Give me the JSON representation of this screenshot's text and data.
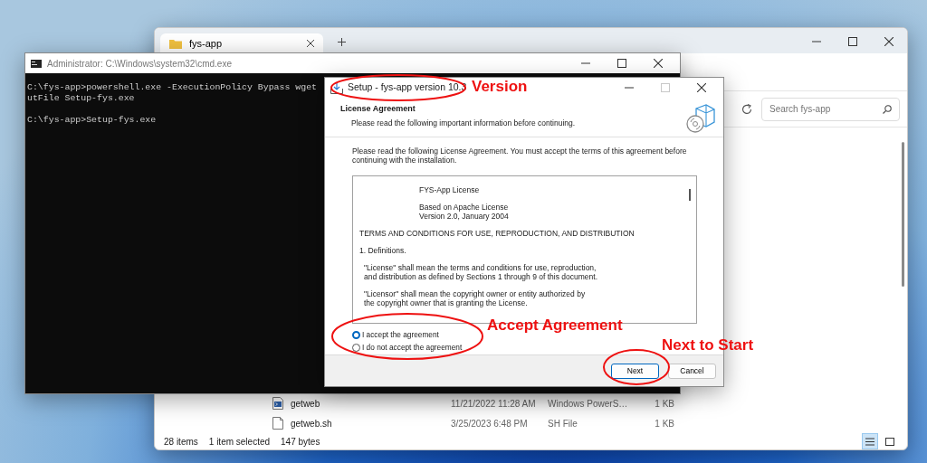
{
  "explorer": {
    "tab": {
      "label": "fys-app"
    },
    "search": {
      "placeholder": "Search fys-app"
    },
    "files": [
      {
        "name": "getweb",
        "date": "11/21/2022 11:28 AM",
        "type": "Windows PowerS…",
        "size": "1 KB",
        "kind": "script"
      },
      {
        "name": "getweb.sh",
        "date": "3/25/2023 6:48 PM",
        "type": "SH File",
        "size": "1 KB",
        "kind": "document"
      }
    ],
    "status_bar": [
      "28 items",
      "1 item selected",
      "147 bytes"
    ],
    "views": [
      {
        "kind": "details",
        "selected": true
      },
      {
        "kind": "tiles",
        "selected": false
      }
    ]
  },
  "console": {
    "title": "Administrator: C:\\Windows\\system32\\cmd.exe",
    "blocks": [
      [
        "C:\\fys-app>powershell.exe -ExecutionPolicy Bypass wget",
        "utFile Setup-fys.exe"
      ],
      [
        "C:\\fys-app>Setup-fys.exe"
      ]
    ]
  },
  "setup": {
    "title": "Setup - fys-app version 10.3",
    "maximize_disabled": true,
    "heading": "License Agreement",
    "subheading": "Please read the following important information before continuing.",
    "intro": [
      "Please read the following License Agreement. You must accept the terms of this agreement before",
      "continuing with the installation."
    ],
    "license": [
      {
        "kind": "centered",
        "lines": [
          "FYS-App License"
        ]
      },
      {
        "kind": "centered",
        "lines": [
          "Based on Apache License",
          "Version 2.0, January 2004"
        ]
      },
      {
        "kind": "plain",
        "lines": [
          "TERMS AND CONDITIONS FOR USE, REPRODUCTION, AND DISTRIBUTION"
        ]
      },
      {
        "kind": "plain",
        "lines": [
          "1. Definitions."
        ]
      },
      {
        "kind": "indented",
        "lines": [
          "\"License\" shall mean the terms and conditions for use, reproduction,",
          "and distribution as defined by Sections 1 through 9 of this document."
        ]
      },
      {
        "kind": "indented",
        "lines": [
          "\"Licensor\" shall mean the copyright owner or entity authorized by",
          "the copyright owner that is granting the License."
        ]
      }
    ],
    "options": [
      {
        "label": "I accept the agreement",
        "selected": true
      },
      {
        "label": "I do not accept the agreement",
        "selected": false
      }
    ],
    "buttons": [
      {
        "label": "Next",
        "kind": "default"
      },
      {
        "label": "Cancel",
        "kind": "normal"
      }
    ]
  },
  "annotations": [
    {
      "text": "Version"
    },
    {
      "text": "Accept Agreement"
    },
    {
      "text": "Next to Start"
    }
  ]
}
